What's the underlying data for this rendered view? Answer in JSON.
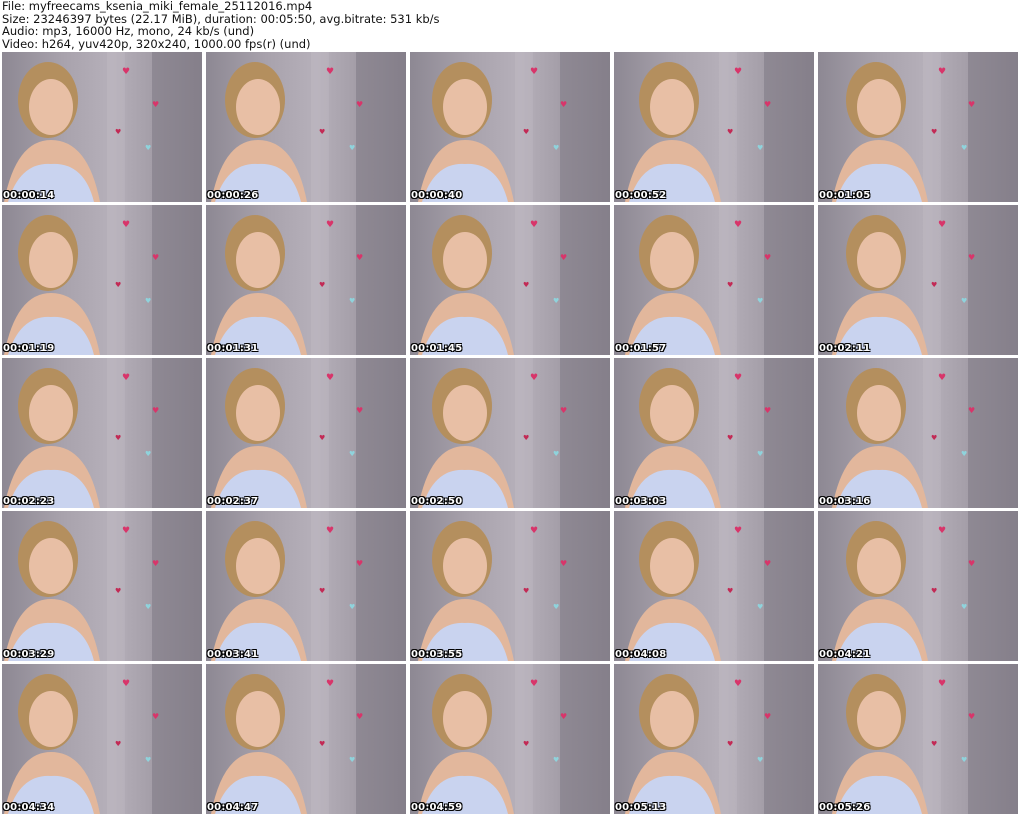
{
  "header": {
    "file_line": "File: myfreecams_ksenia_miki_female_25112016.mp4",
    "size_line": "Size: 23246397 bytes (22.17 MiB), duration: 00:05:50, avg.bitrate: 531 kb/s",
    "audio_line": "Audio: mp3, 16000 Hz, mono, 24 kb/s (und)",
    "video_line": "Video: h264, yuv420p, 320x240, 1000.00 fps(r) (und)"
  },
  "thumbnails": [
    {
      "timestamp": "00:00:14"
    },
    {
      "timestamp": "00:00:26"
    },
    {
      "timestamp": "00:00:40"
    },
    {
      "timestamp": "00:00:52"
    },
    {
      "timestamp": "00:01:05"
    },
    {
      "timestamp": "00:01:19"
    },
    {
      "timestamp": "00:01:31"
    },
    {
      "timestamp": "00:01:45"
    },
    {
      "timestamp": "00:01:57"
    },
    {
      "timestamp": "00:02:11"
    },
    {
      "timestamp": "00:02:23"
    },
    {
      "timestamp": "00:02:37"
    },
    {
      "timestamp": "00:02:50"
    },
    {
      "timestamp": "00:03:03"
    },
    {
      "timestamp": "00:03:16"
    },
    {
      "timestamp": "00:03:29"
    },
    {
      "timestamp": "00:03:41"
    },
    {
      "timestamp": "00:03:55"
    },
    {
      "timestamp": "00:04:08"
    },
    {
      "timestamp": "00:04:21"
    },
    {
      "timestamp": "00:04:34"
    },
    {
      "timestamp": "00:04:47"
    },
    {
      "timestamp": "00:04:59"
    },
    {
      "timestamp": "00:05:13"
    },
    {
      "timestamp": "00:05:26"
    }
  ]
}
